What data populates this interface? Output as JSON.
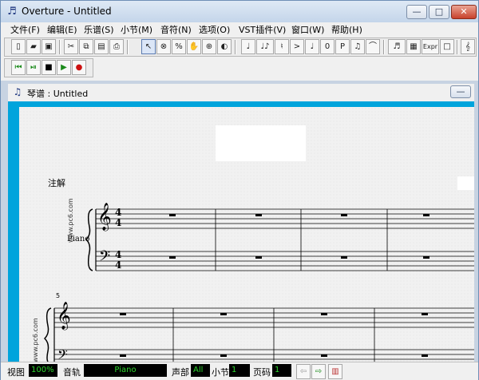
{
  "app": {
    "title": "Overture - Untitled",
    "window_buttons": [
      "—",
      "□",
      "✕"
    ]
  },
  "menu": [
    "文件(F)",
    "编辑(E)",
    "乐谱(S)",
    "小节(M)",
    "音符(N)",
    "选项(O)",
    "VST插件(V)",
    "窗口(W)",
    "帮助(H)"
  ],
  "toolbar1": {
    "file_buttons": [
      "new-icon",
      "open-icon",
      "save-icon"
    ],
    "edit_buttons": [
      "cut-icon",
      "copy-icon",
      "paste-icon",
      "print-icon"
    ],
    "tools": [
      "arrow-tool-icon",
      "erase-tool-icon",
      "percent-tool-icon",
      "hand-tool-icon",
      "zoom-tool-icon",
      "speaker-tool-icon"
    ],
    "notes": [
      "♩",
      "♩♪",
      "♮",
      "&gt;",
      "♩",
      "0",
      "P",
      "♫",
      "⌒"
    ],
    "misc_labels": [
      "Expr"
    ]
  },
  "toolbar2": {
    "transport": [
      "rewind-start-icon",
      "play-from-icon",
      "stop-icon",
      "play-icon",
      "record-icon"
    ]
  },
  "document": {
    "title": "琴谱 : Untitled"
  },
  "score": {
    "annotation_label": "注解",
    "instrument": "Piano",
    "time_signature_top": "4",
    "time_signature_bottom": "4",
    "measure_number": "5",
    "watermark": "www.pc6.com"
  },
  "statusbar": {
    "view_label": "视图",
    "view_value": "100%",
    "track_label": "音轨",
    "track_value": "Piano",
    "voice_label": "声部",
    "voice_value": "All",
    "measure_label": "小节",
    "measure_value": "1",
    "page_label": "页码",
    "page_value": "1"
  }
}
